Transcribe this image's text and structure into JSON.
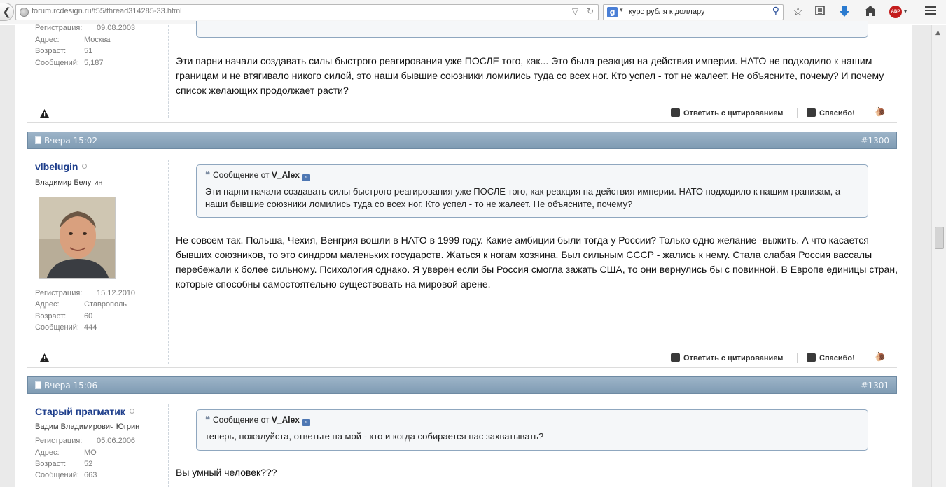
{
  "browser": {
    "back_label": "❮",
    "url": "forum.rcdesign.ru/f55/thread314285-33.html",
    "search_engine_label": "g",
    "search_query": "курс рубля к доллару",
    "abp_label": "ABP"
  },
  "post_prev": {
    "user_info": [
      {
        "label": "Регистрация:",
        "value": "09.08.2003"
      },
      {
        "label": "Адрес:",
        "value": "Москва"
      },
      {
        "label": "Возраст:",
        "value": "51"
      },
      {
        "label": "Сообщений:",
        "value": "5,187"
      }
    ],
    "text": "Эти парни начали создавать силы быстрого реагирования уже ПОСЛЕ того, как... Это была реакция на действия империи. НАТО не подходило к нашим границам и не втягивало никого силой, это наши бывшие союзники ломились туда со всех ног. Кто успел - тот не жалеет. Не объясните, почему? И почему список желающих продолжает расти?",
    "reply_label": "Ответить с цитированием",
    "thanks_label": "Спасибо!"
  },
  "post_1300": {
    "date": "Вчера 15:02",
    "number": "#1300",
    "username": "vlbelugin",
    "usertitle": "Владимир Белугин",
    "user_info": [
      {
        "label": "Регистрация:",
        "value": "15.12.2010"
      },
      {
        "label": "Адрес:",
        "value": "Ставрополь"
      },
      {
        "label": "Возраст:",
        "value": "60"
      },
      {
        "label": "Сообщений:",
        "value": "444"
      }
    ],
    "quote_prefix": "Сообщение от",
    "quote_author": "V_Alex",
    "quote_text": "Эти парни начали создавать силы быстрого реагирования уже ПОСЛЕ того, как реакция на действия империи. НАТО подходило к нашим гранизам, а наши бывшие союзники ломились туда со всех ног. Кто успел - то не жалеет. Не объясните, почему?",
    "text": "Не совсем так. Польша, Чехия, Венгрия вошли в НАТО в 1999 году. Какие амбиции были тогда у России? Только одно желание -выжить. А что касается бывших союзников, то это синдром маленьких государств. Жаться к ногам хозяина. Был сильным СССР - жались к нему. Стала слабая Россия вассалы перебежали к более сильному. Психология однако. Я уверен если бы Россия смогла зажать США, то они вернулись бы с повинной. В Европе единицы стран, которые способны самостоятельно существовать на мировой арене.",
    "reply_label": "Ответить с цитированием",
    "thanks_label": "Спасибо!"
  },
  "post_1301": {
    "date": "Вчера 15:06",
    "number": "#1301",
    "username": "Старый прагматик",
    "usertitle": "Вадим Владимирович Югрин",
    "user_info": [
      {
        "label": "Регистрация:",
        "value": "05.06.2006"
      },
      {
        "label": "Адрес:",
        "value": "МО"
      },
      {
        "label": "Возраст:",
        "value": "52"
      },
      {
        "label": "Сообщений:",
        "value": "663"
      }
    ],
    "quote_prefix": "Сообщение от",
    "quote_author": "V_Alex",
    "quote_text": "теперь, пожалуйста, ответьте на мой - кто и когда собирается нас захватывать?",
    "text": "Вы умный человек???"
  }
}
